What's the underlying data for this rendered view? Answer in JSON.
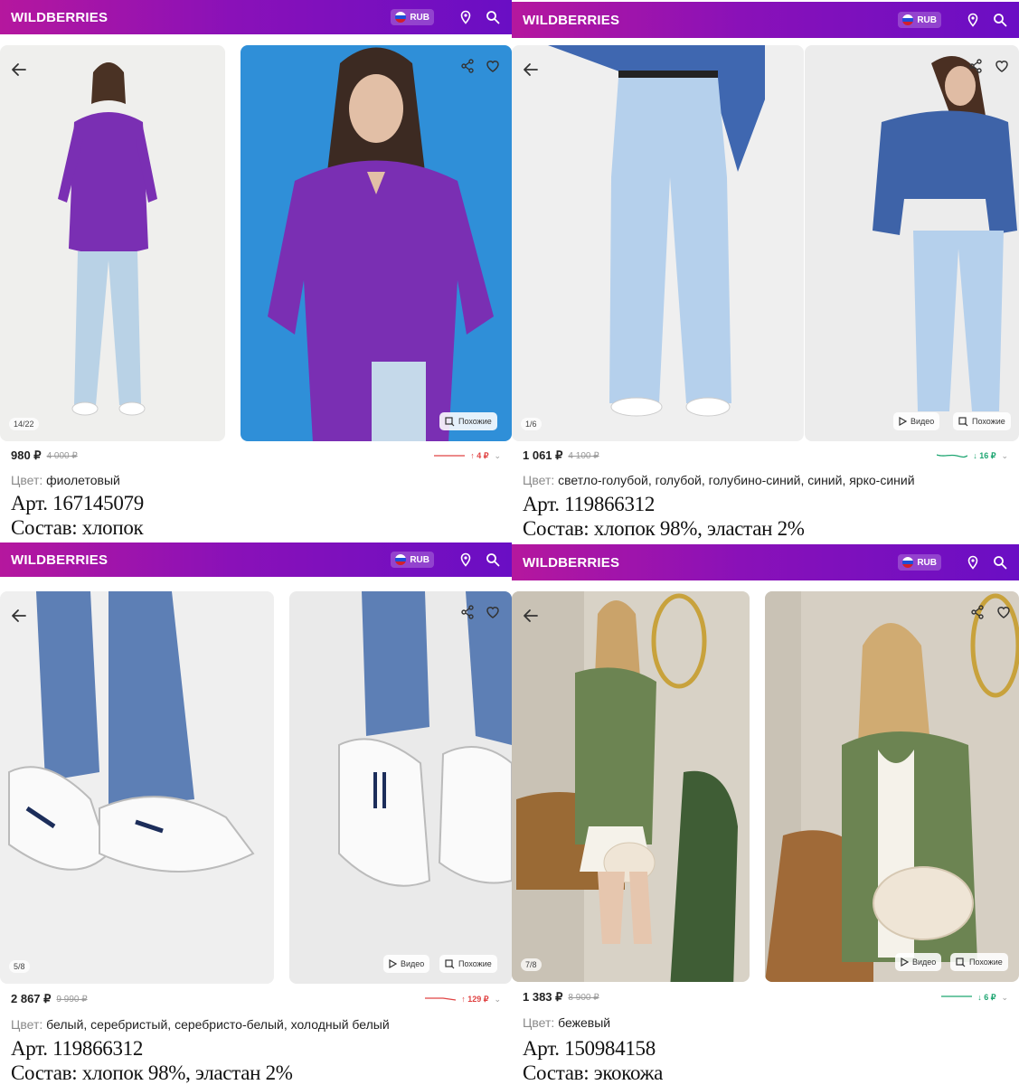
{
  "header": {
    "brand": "WILDBERRIES",
    "currency": "RUB"
  },
  "color_label": "Цвет:",
  "buttons": {
    "video": "Видео",
    "similar": "Похожие"
  },
  "panels": [
    {
      "counter": "14/22",
      "price": "980 ₽",
      "old_price": "4 000 ₽",
      "trend": {
        "direction": "up",
        "text": "↑ 4 ₽",
        "color": "#e04343"
      },
      "color_value": "фиолетовый",
      "article": "Арт. 167145079",
      "composition": "Состав: хлопок"
    },
    {
      "counter": "1/6",
      "price": "1 061 ₽",
      "old_price": "4 100 ₽",
      "trend": {
        "direction": "down",
        "text": "↓ 16 ₽",
        "color": "#1fa672"
      },
      "color_value": "светло-голубой, голубой, голубино-синий, синий, ярко-синий",
      "article": "Арт. 119866312",
      "composition": "Состав: хлопок 98%, эластан 2%"
    },
    {
      "counter": "5/8",
      "price": "2 867 ₽",
      "old_price": "9 990 ₽",
      "trend": {
        "direction": "up",
        "text": "↑ 129 ₽",
        "color": "#e04343"
      },
      "color_value": "белый, серебристый, серебристо-белый, холодный белый",
      "article": "Арт. 119866312",
      "composition": "Состав: хлопок 98%, эластан 2%"
    },
    {
      "counter": "7/8",
      "price": "1 383 ₽",
      "old_price": "8 900 ₽",
      "trend": {
        "direction": "down",
        "text": "↓ 6 ₽",
        "color": "#1fa672"
      },
      "color_value": "бежевый",
      "article": "Арт. 150984158",
      "composition": "Состав: экокожа"
    }
  ],
  "colors": {
    "brand_start": "#b5179e",
    "brand_end": "#6a0ec4",
    "price_up": "#e04343",
    "price_down": "#1fa672"
  }
}
